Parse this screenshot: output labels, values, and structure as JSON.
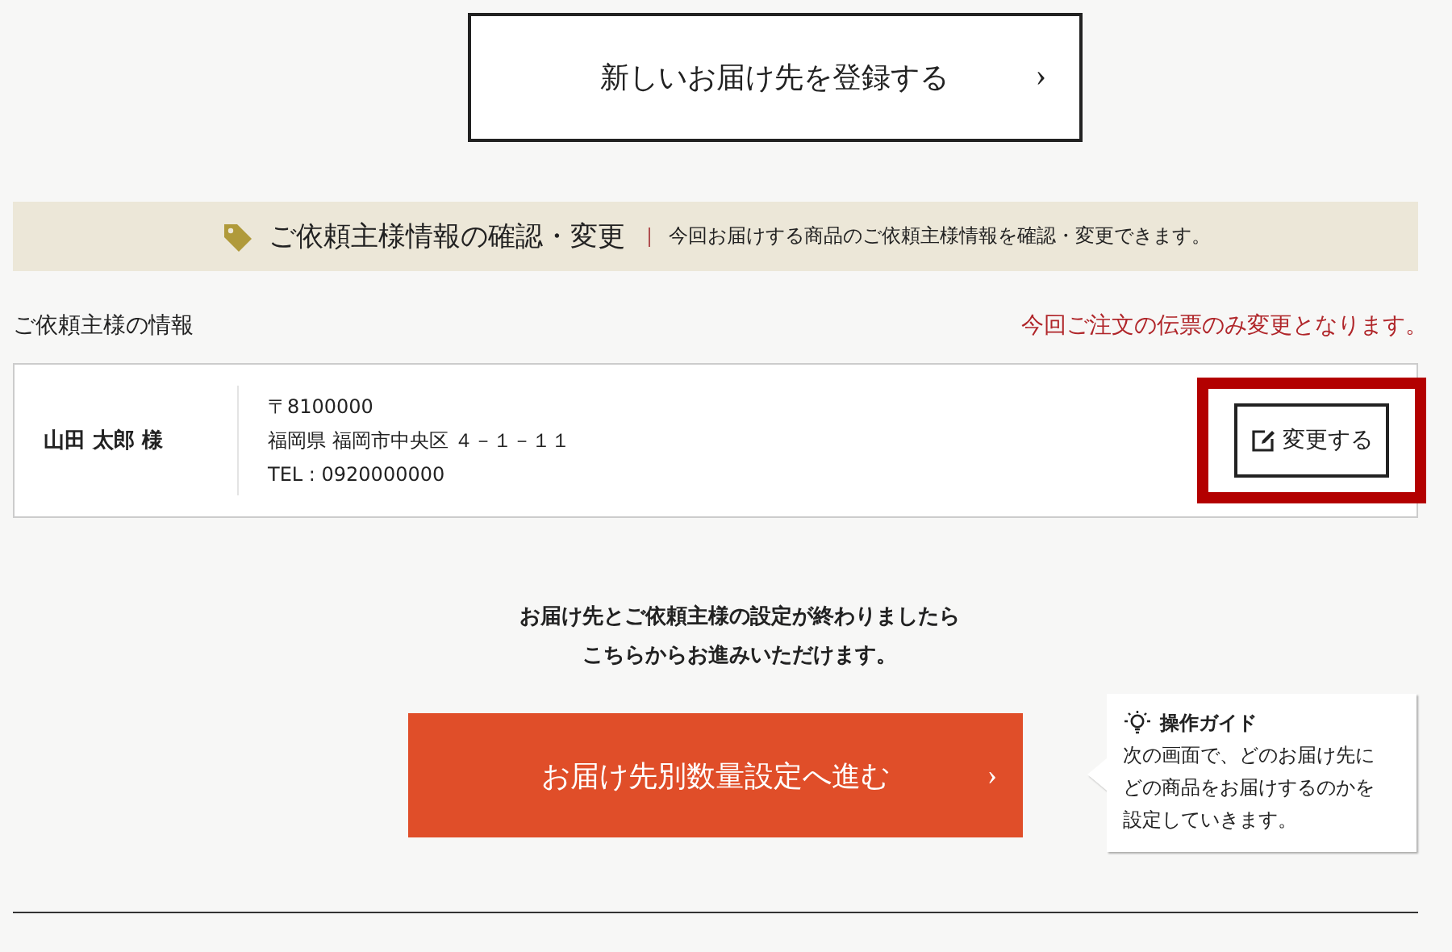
{
  "add_address_button": {
    "label": "新しいお届け先を登録する",
    "chevron": "›"
  },
  "section_banner": {
    "title": "ご依頼主様情報の確認・変更",
    "description": "今回お届けする商品のご依頼主様情報を確認・変更できます。"
  },
  "sender_section": {
    "label": "ご依頼主様の情報",
    "notice": "今回ご注文の伝票のみ変更となります。"
  },
  "sender_card": {
    "name": "山田 太郎 様",
    "address_lines": [
      "〒8100000",
      "福岡県 福岡市中央区 ４－１－１１",
      "TEL : 0920000000"
    ],
    "edit_button": {
      "label": "変更する",
      "highlighted": true
    }
  },
  "instruction_lines": [
    "お届け先とご依頼主様の設定が終わりましたら",
    "こちらからお進みいただけます。"
  ],
  "proceed_button": {
    "label": "お届け先別数量設定へ進む",
    "chevron": "›"
  },
  "guide_tooltip": {
    "title": "操作ガイド",
    "lines": [
      "次の画面で、どのお届け先に",
      "どの商品をお届けするのかを",
      "設定していきます。"
    ]
  }
}
